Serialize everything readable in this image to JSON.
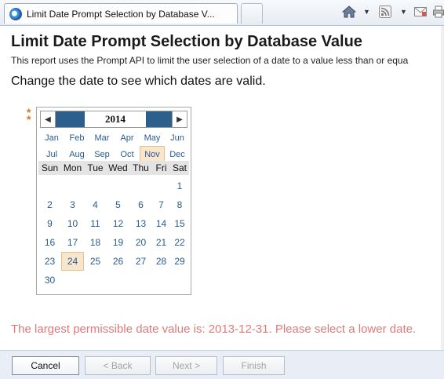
{
  "browser": {
    "tab_title": "Limit Date Prompt Selection by Database V...",
    "tab_close": "×",
    "dropdown_glyph": "▼"
  },
  "page": {
    "title": "Limit Date Prompt Selection by Database Value",
    "description": "This report uses the Prompt API to limit the user selection of a date to a value less than or equa",
    "instruction": "Change the date to see which dates are valid.",
    "required_marker": "*",
    "error": "The largest permissible date value is: 2013-12-31. Please select a lower date."
  },
  "calendar": {
    "year": "2014",
    "prev_glyph": "◀",
    "next_glyph": "▶",
    "months": [
      "Jan",
      "Feb",
      "Mar",
      "Apr",
      "May",
      "Jun",
      "Jul",
      "Aug",
      "Sep",
      "Oct",
      "Nov",
      "Dec"
    ],
    "selected_month": "Nov",
    "weekdays": [
      "Sun",
      "Mon",
      "Tue",
      "Wed",
      "Thu",
      "Fri",
      "Sat"
    ],
    "days": [
      "",
      "",
      "",
      "",
      "",
      "",
      "1",
      "2",
      "3",
      "4",
      "5",
      "6",
      "7",
      "8",
      "9",
      "10",
      "11",
      "12",
      "13",
      "14",
      "15",
      "16",
      "17",
      "18",
      "19",
      "20",
      "21",
      "22",
      "23",
      "24",
      "25",
      "26",
      "27",
      "28",
      "29",
      "30"
    ],
    "selected_day": "24"
  },
  "footer": {
    "cancel": "Cancel",
    "back": "< Back",
    "next": "Next >",
    "finish": "Finish"
  },
  "icons": {
    "home": "home-icon",
    "rss": "rss-feed-icon",
    "mail": "mail-icon",
    "print": "print-icon"
  },
  "colors": {
    "year_bar": "#2d5f8c",
    "link": "#2a5b8d",
    "selected_bg": "#f8e6cc",
    "error": "#e27a7a",
    "required": "#e0701a"
  }
}
